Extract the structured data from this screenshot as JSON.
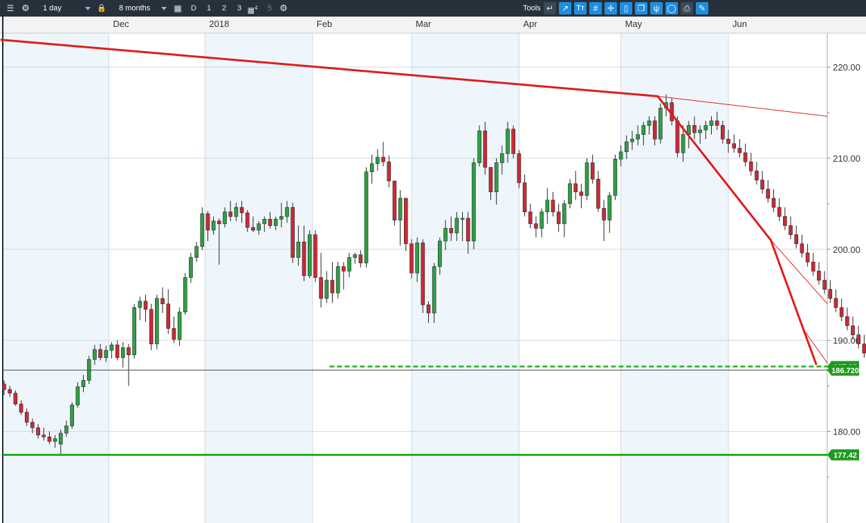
{
  "toolbar": {
    "interval": "1 day",
    "range": "8 months",
    "period_buttons": [
      "D",
      "1",
      "2",
      "3",
      "4",
      "5"
    ],
    "tools_label": "Tools"
  },
  "colors": {
    "up_candle": "#2ea043",
    "down_candle": "#cc2a36",
    "trendline": "#e01b1b",
    "support_line": "#1fb01f",
    "price_tag": "#1f9a1f",
    "toolbar_bg": "#26313c",
    "shade": "#eef6fc"
  },
  "icons": [
    "menu-icon",
    "gear-icon",
    "lock-icon",
    "calendar-icon",
    "back-arrow-icon",
    "line-tool-icon",
    "text-tool-icon",
    "grid-icon",
    "crosshair-icon",
    "candle-icon",
    "window-icon",
    "fork-icon",
    "shape-icon",
    "print-icon",
    "settings-tools-icon"
  ],
  "chart_data": {
    "type": "candlestick",
    "title": "",
    "x_labels": [
      {
        "label": "Dec",
        "index": 18.5
      },
      {
        "label": "2018",
        "index": 35.5
      },
      {
        "label": "Feb",
        "index": 54.5
      },
      {
        "label": "Mar",
        "index": 72
      },
      {
        "label": "Apr",
        "index": 91
      },
      {
        "label": "May",
        "index": 109
      },
      {
        "label": "Jun",
        "index": 128
      }
    ],
    "shaded_month_index_ranges": [
      [
        0,
        18.5
      ],
      [
        35.5,
        54.5
      ],
      [
        72,
        91
      ],
      [
        109,
        128
      ]
    ],
    "ylim": [
      173.5,
      223.5
    ],
    "y_ticks": [
      180,
      190,
      200,
      210,
      220
    ],
    "y_tick_labels": [
      "180.00",
      "190.00",
      "200.00",
      "210.00",
      "220.00"
    ],
    "last_price": "186.720",
    "last_price_value": 186.72,
    "support_level": 177.42,
    "support_label": "177.42",
    "support_level_2": 187.12,
    "support_label_2": "187.12",
    "trendlines": [
      {
        "from": [
          -0.5,
          223.0
        ],
        "to": [
          115.5,
          216.8
        ],
        "width": 3
      },
      {
        "from": [
          115.5,
          216.8
        ],
        "to": [
          145.5,
          214.6
        ],
        "width": 1
      },
      {
        "from": [
          115.5,
          216.8
        ],
        "to": [
          135.5,
          201.0
        ],
        "width": 3
      },
      {
        "from": [
          135.5,
          201.0
        ],
        "to": [
          145.5,
          194.0
        ],
        "width": 1
      },
      {
        "from": [
          135.5,
          201.0
        ],
        "to": [
          143.5,
          187.4
        ],
        "width": 3
      },
      {
        "from": [
          141.5,
          191.0
        ],
        "to": [
          145.5,
          187.5
        ],
        "width": 1
      }
    ],
    "candles": [
      [
        185.2,
        185.6,
        184.0,
        184.6
      ],
      [
        184.6,
        185.0,
        183.8,
        184.2
      ],
      [
        184.2,
        184.5,
        182.8,
        183.0
      ],
      [
        183.0,
        183.4,
        181.8,
        182.1
      ],
      [
        182.1,
        182.5,
        180.6,
        181.0
      ],
      [
        181.0,
        181.4,
        179.8,
        180.4
      ],
      [
        180.4,
        180.8,
        179.2,
        179.6
      ],
      [
        179.6,
        180.4,
        179.0,
        179.4
      ],
      [
        179.4,
        180.0,
        178.6,
        178.9
      ],
      [
        178.9,
        179.6,
        178.2,
        179.2
      ],
      [
        178.6,
        180.2,
        177.4,
        179.8
      ],
      [
        179.8,
        181.2,
        179.4,
        180.6
      ],
      [
        180.6,
        183.2,
        180.3,
        182.9
      ],
      [
        182.9,
        185.4,
        182.6,
        184.9
      ],
      [
        184.9,
        186.2,
        184.3,
        185.6
      ],
      [
        185.6,
        188.3,
        185.2,
        187.9
      ],
      [
        187.9,
        189.5,
        187.3,
        189.0
      ],
      [
        189.0,
        189.6,
        187.8,
        188.1
      ],
      [
        188.1,
        189.4,
        187.6,
        188.9
      ],
      [
        188.9,
        189.8,
        188.0,
        189.5
      ],
      [
        189.5,
        190.0,
        187.8,
        188.1
      ],
      [
        188.1,
        189.8,
        187.0,
        189.2
      ],
      [
        189.2,
        189.6,
        185.0,
        188.4
      ],
      [
        188.4,
        194.0,
        188.0,
        193.6
      ],
      [
        193.6,
        194.8,
        192.2,
        194.3
      ],
      [
        194.3,
        195.0,
        192.0,
        193.4
      ],
      [
        193.4,
        194.0,
        188.9,
        189.6
      ],
      [
        189.6,
        195.0,
        189.0,
        194.6
      ],
      [
        194.6,
        195.8,
        193.0,
        194.0
      ],
      [
        194.0,
        195.6,
        190.7,
        191.3
      ],
      [
        191.3,
        192.6,
        189.7,
        190.1
      ],
      [
        190.1,
        193.6,
        189.4,
        193.1
      ],
      [
        193.1,
        197.4,
        192.8,
        196.9
      ],
      [
        196.9,
        199.6,
        196.3,
        199.1
      ],
      [
        199.1,
        200.8,
        198.6,
        200.3
      ],
      [
        200.3,
        204.6,
        199.9,
        203.9
      ],
      [
        203.9,
        204.2,
        200.9,
        202.1
      ],
      [
        202.1,
        203.6,
        201.6,
        203.1
      ],
      [
        203.1,
        203.4,
        198.3,
        202.8
      ],
      [
        202.8,
        204.6,
        202.4,
        204.1
      ],
      [
        204.1,
        205.3,
        203.1,
        203.6
      ],
      [
        203.6,
        205.1,
        203.1,
        204.6
      ],
      [
        204.6,
        205.3,
        202.9,
        204.0
      ],
      [
        204.0,
        204.3,
        201.9,
        202.4
      ],
      [
        202.4,
        203.6,
        201.9,
        202.1
      ],
      [
        202.1,
        203.1,
        201.6,
        202.8
      ],
      [
        202.8,
        203.6,
        201.9,
        203.3
      ],
      [
        203.3,
        204.1,
        202.3,
        202.6
      ],
      [
        202.6,
        203.6,
        202.1,
        203.3
      ],
      [
        203.3,
        205.1,
        202.4,
        203.6
      ],
      [
        203.6,
        205.3,
        202.9,
        204.6
      ],
      [
        204.6,
        205.1,
        198.5,
        199.1
      ],
      [
        199.1,
        202.6,
        198.2,
        200.8
      ],
      [
        200.8,
        202.6,
        196.5,
        197.1
      ],
      [
        197.1,
        202.1,
        196.8,
        201.6
      ],
      [
        201.6,
        202.1,
        196.4,
        196.9
      ],
      [
        196.9,
        199.6,
        193.6,
        194.6
      ],
      [
        194.6,
        197.6,
        194.1,
        196.6
      ],
      [
        196.6,
        198.6,
        194.1,
        195.2
      ],
      [
        195.2,
        198.6,
        194.6,
        198.1
      ],
      [
        198.1,
        198.6,
        195.6,
        197.6
      ],
      [
        197.6,
        199.6,
        196.9,
        199.1
      ],
      [
        199.1,
        199.6,
        198.4,
        199.4
      ],
      [
        199.4,
        199.9,
        198.0,
        198.5
      ],
      [
        198.5,
        209.0,
        198.0,
        208.5
      ],
      [
        208.5,
        210.4,
        207.2,
        209.4
      ],
      [
        209.4,
        211.0,
        208.6,
        210.1
      ],
      [
        210.1,
        211.8,
        209.1,
        209.6
      ],
      [
        209.6,
        210.3,
        206.8,
        207.5
      ],
      [
        207.5,
        205.6,
        202.6,
        203.2
      ],
      [
        203.2,
        206.5,
        200.4,
        205.6
      ],
      [
        205.6,
        201.4,
        199.8,
        200.6
      ],
      [
        200.6,
        201.1,
        196.8,
        197.4
      ],
      [
        197.4,
        201.3,
        196.4,
        200.7
      ],
      [
        200.7,
        201.1,
        193.0,
        193.9
      ],
      [
        193.9,
        194.3,
        191.9,
        193.0
      ],
      [
        193.0,
        198.5,
        191.9,
        198.1
      ],
      [
        198.1,
        201.3,
        197.2,
        200.9
      ],
      [
        200.9,
        203.2,
        199.9,
        202.3
      ],
      [
        202.3,
        203.6,
        200.9,
        201.8
      ],
      [
        201.8,
        204.1,
        200.9,
        203.4
      ],
      [
        203.4,
        204.1,
        200.9,
        203.4
      ],
      [
        203.4,
        204.1,
        199.5,
        200.9
      ],
      [
        200.9,
        210.0,
        200.0,
        209.5
      ],
      [
        209.5,
        213.6,
        209.1,
        213.0
      ],
      [
        213.0,
        214.0,
        208.2,
        209.0
      ],
      [
        209.0,
        208.6,
        205.4,
        206.3
      ],
      [
        206.3,
        210.0,
        204.9,
        209.5
      ],
      [
        209.5,
        211.4,
        208.2,
        210.5
      ],
      [
        210.5,
        214.0,
        209.5,
        213.2
      ],
      [
        213.2,
        213.6,
        210.0,
        210.5
      ],
      [
        210.5,
        210.9,
        206.7,
        207.3
      ],
      [
        207.3,
        208.2,
        203.6,
        204.1
      ],
      [
        204.1,
        205.0,
        202.3,
        202.8
      ],
      [
        202.8,
        203.6,
        201.3,
        202.3
      ],
      [
        202.3,
        204.5,
        201.3,
        204.1
      ],
      [
        204.1,
        206.7,
        202.8,
        205.4
      ],
      [
        205.4,
        206.3,
        203.6,
        204.1
      ],
      [
        204.1,
        205.0,
        201.9,
        202.8
      ],
      [
        202.8,
        205.4,
        201.3,
        205.0
      ],
      [
        205.0,
        207.7,
        204.5,
        207.2
      ],
      [
        207.2,
        208.6,
        205.4,
        206.3
      ],
      [
        206.3,
        207.2,
        204.5,
        205.9
      ],
      [
        205.9,
        210.0,
        205.4,
        209.5
      ],
      [
        209.5,
        210.4,
        207.2,
        207.7
      ],
      [
        207.7,
        208.6,
        204.1,
        204.5
      ],
      [
        204.5,
        205.4,
        200.9,
        203.2
      ],
      [
        203.2,
        206.3,
        201.8,
        205.9
      ],
      [
        205.9,
        210.4,
        205.4,
        209.9
      ],
      [
        209.9,
        211.4,
        209.1,
        210.7
      ],
      [
        210.7,
        212.5,
        209.9,
        211.8
      ],
      [
        211.8,
        213.0,
        210.9,
        212.1
      ],
      [
        212.1,
        213.6,
        211.4,
        212.6
      ],
      [
        212.6,
        214.0,
        211.4,
        213.6
      ],
      [
        213.6,
        214.6,
        212.6,
        214.1
      ],
      [
        214.1,
        214.6,
        211.4,
        212.1
      ],
      [
        212.1,
        216.0,
        211.6,
        215.5
      ],
      [
        215.5,
        217.0,
        214.6,
        216.1
      ],
      [
        216.1,
        216.6,
        213.6,
        214.1
      ],
      [
        214.1,
        214.6,
        210.1,
        210.6
      ],
      [
        210.6,
        213.6,
        209.6,
        212.6
      ],
      [
        212.6,
        214.1,
        211.1,
        213.6
      ],
      [
        213.6,
        214.6,
        212.1,
        212.8
      ],
      [
        212.8,
        213.6,
        211.6,
        213.1
      ],
      [
        213.1,
        214.1,
        212.1,
        213.6
      ],
      [
        213.6,
        214.6,
        212.6,
        214.1
      ],
      [
        214.1,
        215.1,
        213.1,
        213.6
      ],
      [
        213.6,
        214.1,
        211.6,
        212.1
      ],
      [
        212.1,
        213.1,
        210.6,
        211.6
      ],
      [
        211.6,
        212.6,
        210.6,
        211.1
      ],
      [
        211.1,
        212.1,
        210.1,
        210.6
      ],
      [
        210.6,
        211.6,
        209.1,
        209.6
      ],
      [
        209.6,
        210.6,
        208.1,
        208.6
      ],
      [
        208.6,
        209.6,
        207.1,
        207.6
      ],
      [
        207.6,
        208.6,
        206.1,
        206.6
      ],
      [
        206.6,
        207.6,
        205.1,
        205.6
      ],
      [
        205.6,
        206.6,
        204.1,
        204.6
      ],
      [
        204.6,
        205.6,
        203.1,
        203.6
      ],
      [
        203.6,
        204.6,
        202.1,
        202.6
      ],
      [
        202.6,
        203.6,
        201.1,
        201.6
      ],
      [
        201.6,
        202.6,
        200.1,
        200.6
      ],
      [
        200.6,
        201.6,
        199.1,
        199.6
      ],
      [
        199.6,
        200.6,
        198.1,
        198.6
      ],
      [
        198.6,
        199.6,
        197.1,
        197.6
      ],
      [
        197.6,
        198.6,
        196.1,
        196.6
      ],
      [
        196.6,
        197.6,
        195.1,
        195.6
      ],
      [
        195.6,
        196.6,
        194.1,
        194.6
      ],
      [
        194.6,
        195.6,
        193.1,
        193.6
      ],
      [
        193.6,
        194.6,
        192.1,
        192.6
      ],
      [
        192.6,
        193.6,
        191.1,
        191.6
      ],
      [
        191.6,
        192.6,
        190.1,
        190.6
      ],
      [
        190.6,
        191.6,
        189.1,
        189.6
      ],
      [
        189.6,
        190.6,
        188.1,
        188.6
      ],
      [
        188.6,
        189.6,
        186.5,
        186.72
      ]
    ]
  }
}
